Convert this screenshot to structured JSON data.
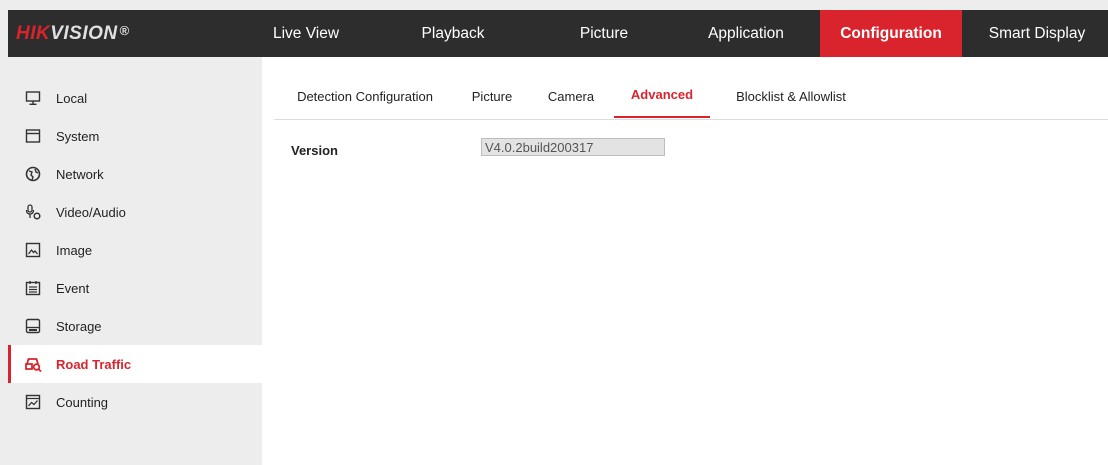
{
  "brand": {
    "part1": "HIK",
    "part2": "VISION",
    "reg": "®"
  },
  "nav": [
    {
      "label": "Live View"
    },
    {
      "label": "Playback"
    },
    {
      "label": "Picture"
    },
    {
      "label": "Application"
    },
    {
      "label": "Configuration",
      "active": true
    },
    {
      "label": "Smart Display"
    }
  ],
  "sidebar": {
    "items": [
      {
        "label": "Local",
        "icon": "monitor-icon"
      },
      {
        "label": "System",
        "icon": "window-icon"
      },
      {
        "label": "Network",
        "icon": "globe-icon"
      },
      {
        "label": "Video/Audio",
        "icon": "microphone-icon"
      },
      {
        "label": "Image",
        "icon": "image-icon"
      },
      {
        "label": "Event",
        "icon": "calendar-icon"
      },
      {
        "label": "Storage",
        "icon": "disk-icon"
      },
      {
        "label": "Road Traffic",
        "icon": "car-search-icon",
        "active": true
      },
      {
        "label": "Counting",
        "icon": "chart-icon"
      }
    ]
  },
  "tabs": [
    {
      "label": "Detection Configuration"
    },
    {
      "label": "Picture"
    },
    {
      "label": "Camera"
    },
    {
      "label": "Advanced",
      "active": true
    },
    {
      "label": "Blocklist & Allowlist"
    }
  ],
  "form": {
    "version_label": "Version",
    "version_value": "V4.0.2build200317"
  },
  "colors": {
    "accent": "#d9232d",
    "topbar": "#2d2d2d",
    "sidebar": "#ededed"
  }
}
